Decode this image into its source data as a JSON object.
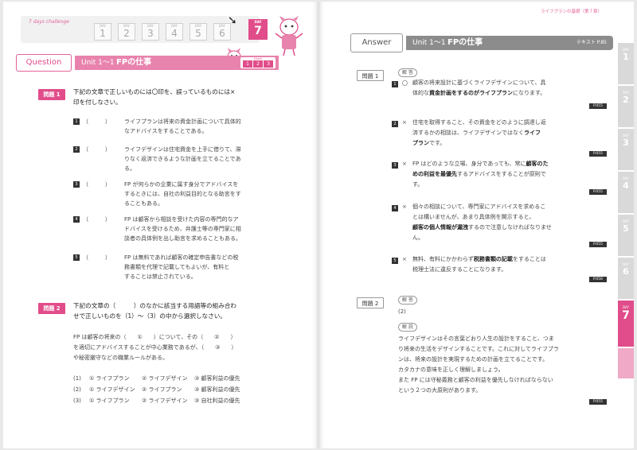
{
  "left": {
    "challenge_label": "7 days challenge",
    "day_prefix": "DAY",
    "days": [
      "1",
      "2",
      "3",
      "4",
      "5",
      "6",
      "7"
    ],
    "active_day": "7",
    "question_badge": "Question",
    "unit": "Unit 1～1",
    "section_title": "FPの仕事",
    "check_label": "Check",
    "check_boxes": [
      "1",
      "2",
      "3"
    ],
    "problem1": {
      "badge": "問題 1",
      "text": [
        "下記の文章で正しいものには〇印を、誤っているものには×",
        "印を付しなさい。"
      ],
      "items": [
        {
          "num": "1",
          "paren": "（　　　）",
          "lines": [
            "ライフプランは将来の資金計画について具体的",
            "なアドバイスをすることである。"
          ]
        },
        {
          "num": "2",
          "paren": "（　　　）",
          "lines": [
            "ライフデザインは住宅資金を上手に借りて、滞",
            "りなく返済できるような計画を立てることであ",
            "る。"
          ]
        },
        {
          "num": "3",
          "paren": "（　　　）",
          "lines": [
            "FP が何らかの企業に属す身分でアドバイスを",
            "するときには、自社の利益目的となる助言をす",
            "ることもある。"
          ]
        },
        {
          "num": "4",
          "paren": "（　　　）",
          "lines": [
            "FP は顧客から相談を受けた内容の専門的なア",
            "ドバイスを受けるため、弁護士等の専門家に相",
            "談者の具体例を出し助言を求めることもある。"
          ]
        },
        {
          "num": "5",
          "paren": "（　　　）",
          "lines": [
            "FP は無料であれば顧客の確定申告書などの税",
            "務書類を代理で記載してもよいが、有料と",
            "することは禁止されている。"
          ]
        }
      ]
    },
    "problem2": {
      "badge": "問題 2",
      "text": [
        "下記の文章の（　　　）のなかに該当する用語等の組み合わ",
        "せで正しいものを（1）～（3）の中から選択しなさい。"
      ],
      "body": [
        "FP は顧客の将来の（　　①　　）について、その（　　②　　）",
        "を適切にアドバイスすることが中心業務であるが、（　　③　　）",
        "や秘密厳守などの職業ルールがある。"
      ],
      "options": [
        [
          "(1)",
          "① ライフプラン",
          "② ライフデザイン",
          "③ 顧客利益の優先"
        ],
        [
          "(2)",
          "① ライフデザイン",
          "② ライフプラン",
          "③ 顧客利益の優先"
        ],
        [
          "(3)",
          "① ライフプラン",
          "② ライフデザイン",
          "③ 自社利益の優先"
        ]
      ]
    }
  },
  "right": {
    "running_head": "ライフプランの基礎（第７章）",
    "answer_badge": "Answer",
    "unit": "Unit 1～1",
    "section_title": "FPの仕事",
    "subtitle": "テキスト P.85",
    "answer1": {
      "badge": "問題 1",
      "tag": "解 答",
      "items": [
        {
          "num": "1",
          "sym": "〇",
          "lines": [
            [
              "顧客の将来設計に基づくライフデザインについて、具",
              ""
            ],
            [
              "体的な",
              ""
            ],
            [
              "資金計画をするのがライフプラン",
              "b"
            ],
            [
              "になります。",
              ""
            ]
          ],
          "ref": "P.055"
        },
        {
          "num": "2",
          "sym": "×",
          "lines": [
            [
              "住宅を取得すること、その資金をどのように調達し返",
              ""
            ],
            [
              "済するかの相談は、ライフデザインではなく",
              ""
            ],
            [
              "ライフ",
              "b"
            ],
            [
              "プラン",
              "b"
            ],
            [
              "です。",
              ""
            ]
          ],
          "ref": "P.055"
        },
        {
          "num": "3",
          "sym": "×",
          "lines": [
            [
              "FP はどのような立場、身分であっても、常に",
              ""
            ],
            [
              "顧客のた",
              "b"
            ],
            [
              "めの利益を最優先",
              "b"
            ],
            [
              "するアドバイスをすることが原則で",
              ""
            ],
            [
              "す。",
              ""
            ]
          ],
          "ref": "P.055"
        },
        {
          "num": "4",
          "sym": "×",
          "lines": [
            [
              "個々の相談について、専門家にアドバイスを求めるこ",
              ""
            ],
            [
              "とは構いませんが、あまり具体例を開示すると、",
              ""
            ],
            [
              "顧客の個人情報が漏洩",
              "b"
            ],
            [
              "するので注意しなければなりませ",
              ""
            ],
            [
              "ん。",
              ""
            ]
          ],
          "ref": "P.055"
        },
        {
          "num": "5",
          "sym": "×",
          "lines": [
            [
              "無料、有料にかかわらず",
              ""
            ],
            [
              "税務書類の記載",
              "b"
            ],
            [
              "をすることは",
              ""
            ],
            [
              "税理士法に違反することになります。",
              ""
            ]
          ],
          "ref": "P.056"
        }
      ]
    },
    "answer2": {
      "badge": "問題 2",
      "tag1": "解 答",
      "answer": "(2)",
      "tag2": "解 説",
      "lines": [
        "ライフデザインはその言葉どおり人生の設計をすること、つま",
        "り将来の生活をデザインすることです。これに対してライフプラ",
        "ンは、将来の設計を実現するための計画を立てることです。",
        "カタカナの意味を正しく理解しましょう。",
        "また FP には守秘義務と顧客の利益を優先しなければならない",
        "という２つの大原則があります。"
      ],
      "ref": "P.055"
    },
    "side_tab_prefix": "DAY",
    "side_tabs": [
      "1",
      "2",
      "3",
      "4",
      "5",
      "6",
      "7"
    ]
  },
  "colors": {
    "accent": "#e14d8a",
    "accent_light": "#e883ad",
    "gray_bar": "#8c8c8c"
  }
}
